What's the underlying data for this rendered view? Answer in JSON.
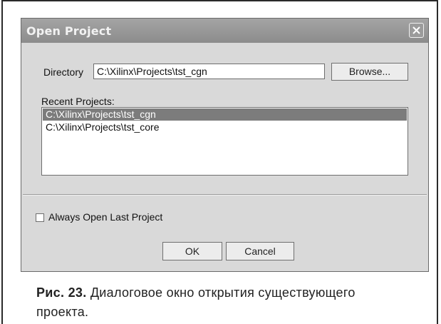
{
  "dialog": {
    "title": "Open Project",
    "directory_label": "Directory",
    "directory_value": "C:\\Xilinx\\Projects\\tst_cgn",
    "browse_label": "Browse...",
    "recent_label": "Recent Projects:",
    "recent_items": [
      {
        "label": "C:\\Xilinx\\Projects\\tst_cgn",
        "selected": true
      },
      {
        "label": "C:\\Xilinx\\Projects\\tst_core",
        "selected": false
      }
    ],
    "always_open_label": "Always Open Last Project",
    "always_open_checked": false,
    "ok_label": "OK",
    "cancel_label": "Cancel"
  },
  "caption": {
    "prefix": "Рис. 23.",
    "text": " Диалоговое окно открытия существующего проекта."
  }
}
